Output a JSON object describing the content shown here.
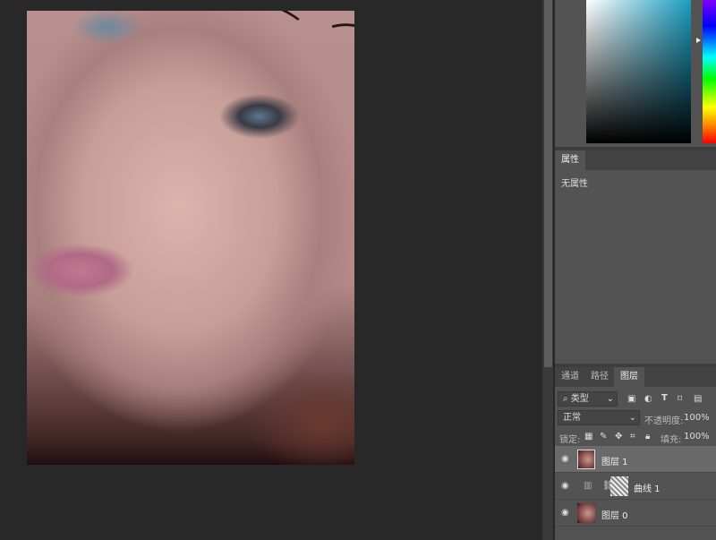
{
  "canvas": {
    "image": "portrait photo"
  },
  "colors": {
    "hue_color": "#1a9cc0",
    "panel_bg": "#535353",
    "canvas_bg": "#282828"
  },
  "properties": {
    "tab": "属性",
    "content": "无属性"
  },
  "layers_panel": {
    "tabs": [
      {
        "label": "通道",
        "active": false
      },
      {
        "label": "路径",
        "active": false
      },
      {
        "label": "图层",
        "active": true
      }
    ],
    "filter": {
      "icon": "search-icon",
      "value": "类型"
    },
    "blend_mode": "正常",
    "opacity_label": "不透明度:",
    "opacity": "100%",
    "lock_label": "锁定:",
    "fill_label": "填充:",
    "fill": "100%",
    "layers": [
      {
        "name": "图层 1",
        "visible": true,
        "selected": true,
        "type": "pixel"
      },
      {
        "name": "曲线 1",
        "visible": true,
        "selected": false,
        "type": "curves-adjustment"
      },
      {
        "name": "图层 0",
        "visible": true,
        "selected": false,
        "type": "pixel"
      }
    ]
  }
}
